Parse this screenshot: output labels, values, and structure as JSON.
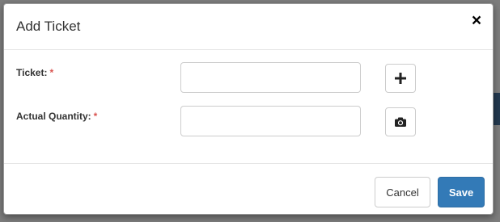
{
  "modal": {
    "title": "Add Ticket",
    "close_symbol": "×"
  },
  "form": {
    "ticket": {
      "label": "Ticket:",
      "required_marker": "*",
      "value": "",
      "action_icon": "plus-icon"
    },
    "actual_quantity": {
      "label": "Actual Quantity:",
      "required_marker": "*",
      "value": "",
      "action_icon": "camera-icon"
    }
  },
  "footer": {
    "cancel_label": "Cancel",
    "save_label": "Save"
  },
  "colors": {
    "primary": "#337ab7",
    "required": "#d9534f",
    "backdrop": "#7d7d7d"
  }
}
